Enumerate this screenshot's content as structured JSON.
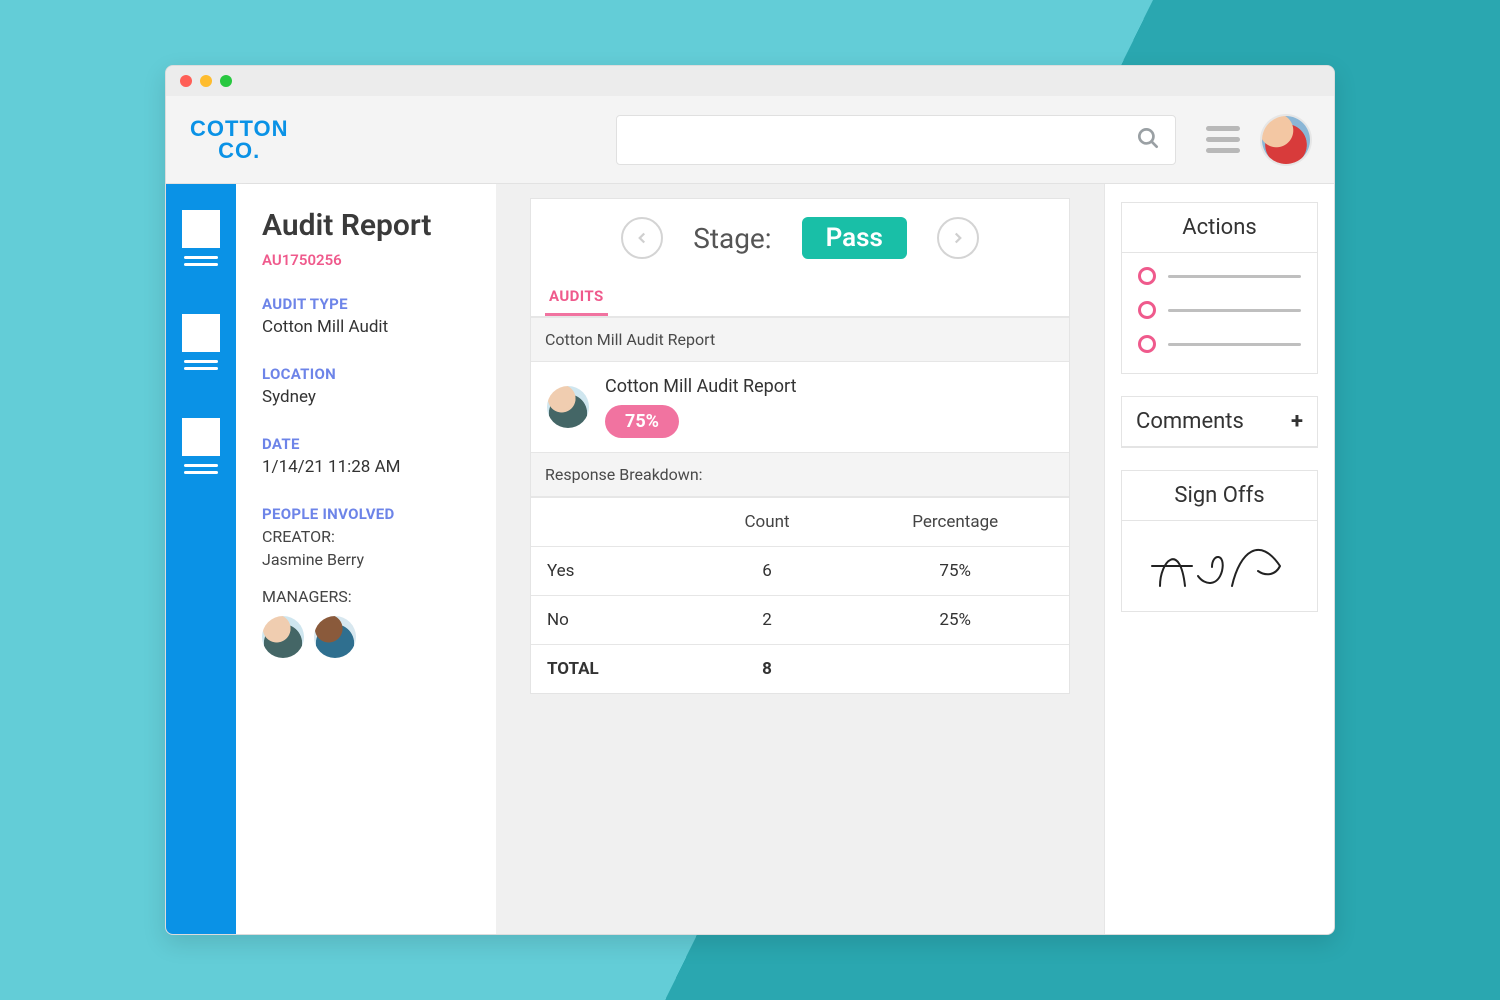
{
  "brand": {
    "line1": "COTTON",
    "line2": "CO."
  },
  "search": {
    "placeholder": ""
  },
  "page": {
    "title": "Audit Report",
    "record_id": "AU1750256"
  },
  "fields": {
    "audit_type": {
      "label": "AUDIT TYPE",
      "value": "Cotton Mill Audit"
    },
    "location": {
      "label": "LOCATION",
      "value": "Sydney"
    },
    "date": {
      "label": "DATE",
      "value": "1/14/21 11:28 AM"
    },
    "people": {
      "label": "PEOPLE INVOLVED",
      "creator_label": "CREATOR:",
      "creator_name": "Jasmine Berry",
      "managers_label": "MANAGERS:"
    }
  },
  "stage": {
    "label": "Stage:",
    "value": "Pass"
  },
  "tabs": {
    "audits": "AUDITS"
  },
  "audit_card": {
    "header": "Cotton Mill Audit Report",
    "item_title": "Cotton Mill Audit Report",
    "score_pct": "75%",
    "breakdown_label": "Response Breakdown:"
  },
  "breakdown": {
    "columns": {
      "blank": "",
      "count": "Count",
      "percentage": "Percentage"
    },
    "rows": [
      {
        "label": "Yes",
        "count": "6",
        "percentage": "75%"
      },
      {
        "label": "No",
        "count": "2",
        "percentage": "25%"
      }
    ],
    "total": {
      "label": "TOTAL",
      "count": "8",
      "percentage": ""
    }
  },
  "right": {
    "actions_title": "Actions",
    "comments_title": "Comments",
    "signoffs_title": "Sign Offs"
  },
  "colors": {
    "brand_blue": "#0a92e6",
    "pink": "#ef5a8c",
    "teal_badge": "#19bfa7",
    "label_blue": "#6d84e8"
  }
}
